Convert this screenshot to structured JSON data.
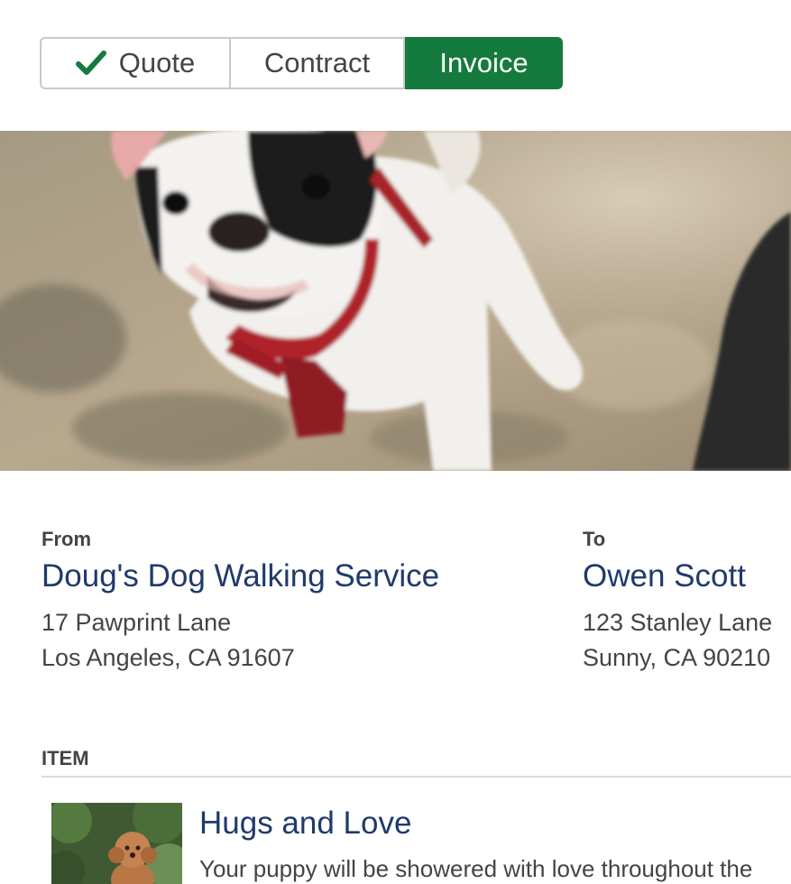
{
  "tabs": [
    {
      "label": "Quote",
      "completed": true
    },
    {
      "label": "Contract",
      "completed": false
    },
    {
      "label": "Invoice",
      "active": true
    }
  ],
  "colors": {
    "accent_green": "#157a3e",
    "name_blue": "#1f3a6b"
  },
  "hero": {
    "icon": "dog-photo"
  },
  "from": {
    "label": "From",
    "name": "Doug's Dog Walking Service",
    "address_line1": "17 Pawprint Lane",
    "address_line2": "Los Angeles, CA 91607"
  },
  "to": {
    "label": "To",
    "name": "Owen Scott",
    "address_line1": "123 Stanley Lane",
    "address_line2": "Sunny, CA 90210"
  },
  "items_section": {
    "header": "ITEM",
    "items": [
      {
        "title": "Hugs and Love",
        "description": "Your puppy will be showered with love throughout the",
        "thumbnail_icon": "puppy-photo"
      }
    ]
  }
}
